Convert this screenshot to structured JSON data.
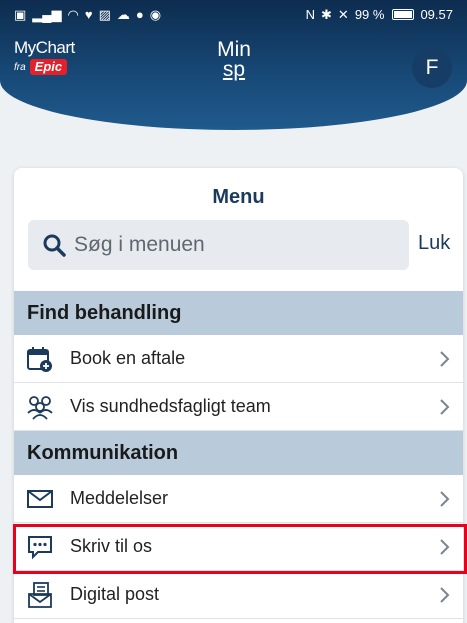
{
  "status_bar": {
    "left_icons": [
      "hd-icon",
      "signal-icon",
      "wifi-icon",
      "heart-icon",
      "image-icon",
      "cloud-icon",
      "facebook-icon",
      "eye-icon"
    ],
    "battery": "99 %",
    "time": "09.57"
  },
  "header": {
    "logo_name": "MyChart",
    "logo_from": "fra",
    "logo_brand": "Epic",
    "title_line1": "Min",
    "title_line2": "sp",
    "avatar_initial": "F"
  },
  "menu": {
    "title": "Menu",
    "search_placeholder": "Søg i menuen",
    "close_label": "Luk",
    "sections": [
      {
        "title": "Find behandling",
        "items": [
          {
            "label": "Book en aftale",
            "icon": "calendar-add-icon"
          },
          {
            "label": "Vis sundhedsfagligt team",
            "icon": "team-icon"
          }
        ]
      },
      {
        "title": "Kommunikation",
        "items": [
          {
            "label": "Meddelelser",
            "icon": "envelope-icon"
          },
          {
            "label": "Skriv til os",
            "icon": "chat-bubble-icon"
          },
          {
            "label": "Digital post",
            "icon": "digital-post-icon"
          }
        ]
      }
    ]
  },
  "colors": {
    "header_dark": "#0d2c4f",
    "header_light": "#1f5a8c",
    "section_bg": "#b9cbdb",
    "accent_text": "#1b3a5c",
    "highlight": "#e8001c",
    "epic_red": "#e4212b"
  }
}
